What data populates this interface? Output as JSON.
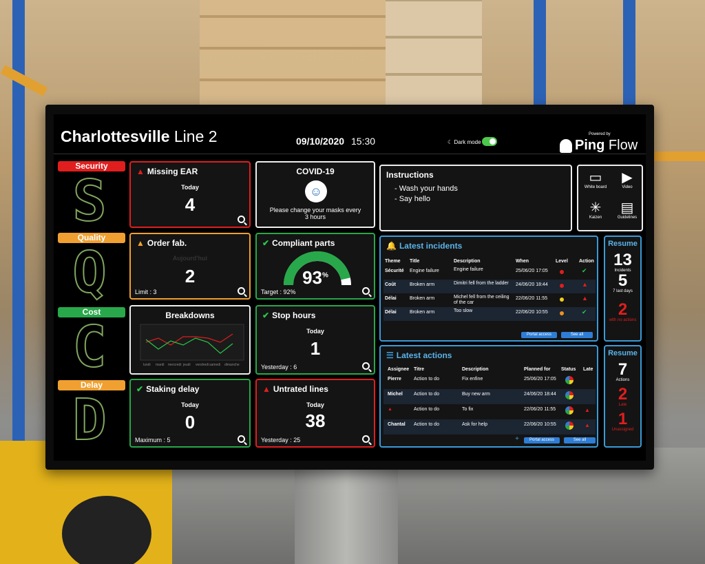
{
  "header": {
    "site": "Charlottesville",
    "line": "Line 2",
    "date": "09/10/2020",
    "time": "15:30",
    "dark_mode": "Dark mode",
    "powered_by": "Powered by",
    "brand_bold": "Ping",
    "brand_light": "Flow"
  },
  "qcdd": [
    {
      "label": "Security",
      "letter": "S",
      "color": "#e01e1e"
    },
    {
      "label": "Quality",
      "letter": "Q",
      "color": "#f0a030"
    },
    {
      "label": "Cost",
      "letter": "C",
      "color": "#28a84a"
    },
    {
      "label": "Delay",
      "letter": "D",
      "color": "#f0a030"
    }
  ],
  "cards": {
    "missing_ear": {
      "title": "Missing EAR",
      "sub": "Today",
      "value": "4"
    },
    "order_fab": {
      "title": "Order fab.",
      "sub": "Aujourd'hui",
      "value": "2",
      "foot": "Limit : 3"
    },
    "breakdowns": {
      "title": "Breakdowns"
    },
    "staking": {
      "title": "Staking delay",
      "sub": "Today",
      "value": "0",
      "foot": "Maximum : 5"
    },
    "covid": {
      "title": "COVID-19",
      "text": "Please change your masks every 3 hours"
    },
    "compliant": {
      "title": "Compliant parts",
      "value": "93",
      "unit": "%",
      "foot": "Target : 92%",
      "fraction": 0.93
    },
    "stop_hours": {
      "title": "Stop hours",
      "sub": "Today",
      "value": "1",
      "foot": "Yesterday : 6"
    },
    "untreated": {
      "title": "Untrated lines",
      "sub": "Today",
      "value": "38",
      "foot": "Yesterday : 25"
    }
  },
  "instructions": {
    "title": "Instructions",
    "lines": [
      "- Wash your hands",
      "- Say hello"
    ]
  },
  "tools": [
    {
      "label": "White board",
      "icon": "whiteboard-icon",
      "glyph": "▭"
    },
    {
      "label": "Video",
      "icon": "video-icon",
      "glyph": "▶"
    },
    {
      "label": "Kaizen",
      "icon": "kaizen-icon",
      "glyph": "✳"
    },
    {
      "label": "Guidelines",
      "icon": "pdf-icon",
      "glyph": "▤"
    }
  ],
  "incidents": {
    "title": "Latest incidents",
    "headers": [
      "Theme",
      "Title",
      "Description",
      "When",
      "Level",
      "Action"
    ],
    "rows": [
      {
        "theme": "Sécurité",
        "title": "Engine failure",
        "desc": "Engine failure",
        "when": "25/06/20 17:05",
        "level": "#e01e1e",
        "action": "✔",
        "action_color": "#28c84a"
      },
      {
        "theme": "Coût",
        "title": "Broken arm",
        "desc": "Dimitri fell from the ladder",
        "when": "24/06/20 18:44",
        "level": "#e01e1e",
        "action": "▲",
        "action_color": "#e01e1e"
      },
      {
        "theme": "Délai",
        "title": "Broken arm",
        "desc": "Michel fell from the ceiling of the car",
        "when": "22/06/20 11:55",
        "level": "#f0d020",
        "action": "▲",
        "action_color": "#e01e1e"
      },
      {
        "theme": "Délai",
        "title": "Broken arm",
        "desc": "Too slow",
        "when": "22/06/20 10:55",
        "level": "#f09020",
        "action": "✔",
        "action_color": "#28c84a"
      }
    ],
    "portal": "Portal access",
    "see_all": "See all"
  },
  "resume1": {
    "title": "Resume",
    "n1": "13",
    "l1": "Incidents",
    "n2": "5",
    "l2": "7 last days",
    "n3": "2",
    "l3": "with no actions"
  },
  "actions": {
    "title": "Latest actions",
    "headers": [
      "Assignee",
      "Titre",
      "Description",
      "Planned for",
      "Status",
      "Late"
    ],
    "rows": [
      {
        "assignee": "Pierre",
        "title": "Action to do",
        "desc": "Fix enfine",
        "planned": "25/06/20 17:05",
        "late": ""
      },
      {
        "assignee": "Michel",
        "title": "Action to do",
        "desc": "Buy new arm",
        "planned": "24/06/20 18:44",
        "late": ""
      },
      {
        "assignee": "▲",
        "title": "Action to do",
        "desc": "To fix",
        "planned": "22/06/20 11:55",
        "late": "▲"
      },
      {
        "assignee": "Chantal",
        "title": "Action to do",
        "desc": "Ask for help",
        "planned": "22/06/20 10:55",
        "late": "▲"
      }
    ],
    "portal": "Portal access",
    "see_all": "See all",
    "add": "+"
  },
  "resume2": {
    "title": "Resume",
    "n1": "7",
    "l1": "Actions",
    "n2": "2",
    "l2": "Late",
    "n3": "1",
    "l3": "Unassigned"
  }
}
